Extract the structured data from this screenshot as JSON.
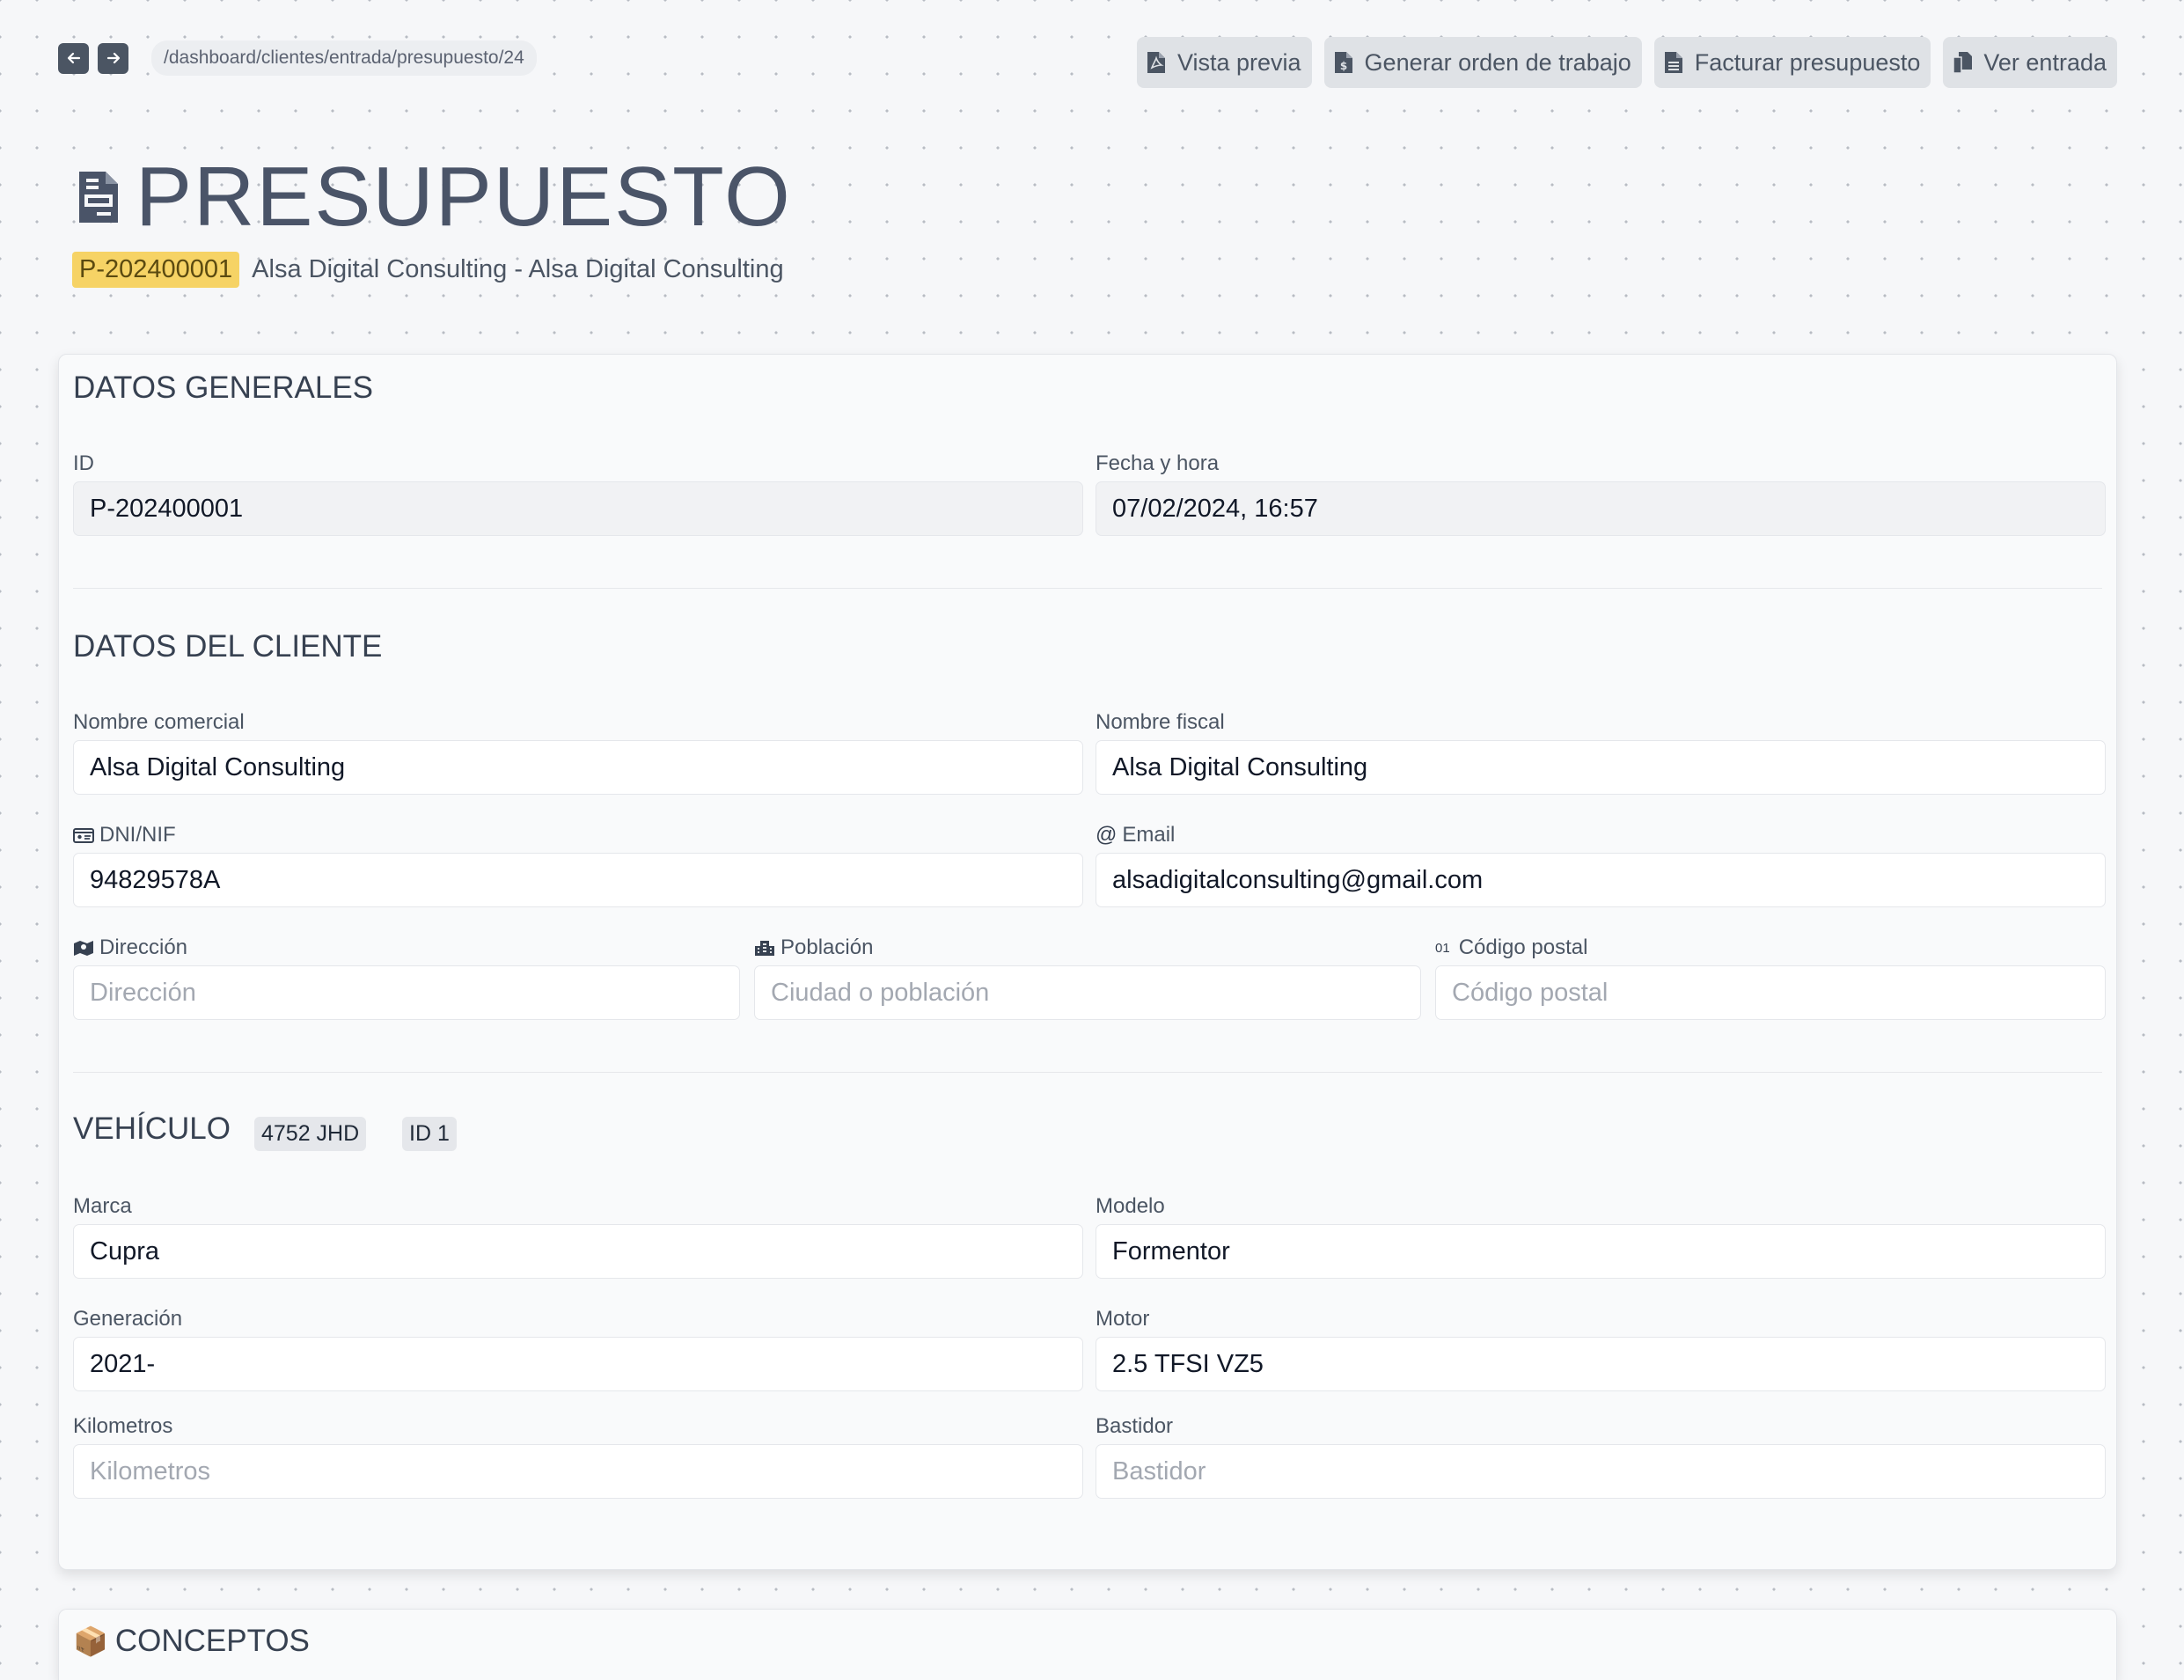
{
  "breadcrumb": "/dashboard/clientes/entrada/presupuesto/24",
  "actions": {
    "preview": "Vista previa",
    "work_order": "Generar orden de trabajo",
    "invoice": "Facturar presupuesto",
    "view_entry": "Ver entrada"
  },
  "header": {
    "title": "PRESUPUESTO",
    "code": "P-202400001",
    "client": "Alsa Digital Consulting - Alsa Digital Consulting"
  },
  "general": {
    "title": "DATOS GENERALES",
    "id_label": "ID",
    "id_value": "P-202400001",
    "date_label": "Fecha y hora",
    "date_value": "07/02/2024, 16:57"
  },
  "client": {
    "title": "DATOS DEL CLIENTE",
    "trade_name_label": "Nombre comercial",
    "trade_name_value": "Alsa Digital Consulting",
    "fiscal_name_label": "Nombre fiscal",
    "fiscal_name_value": "Alsa Digital Consulting",
    "dni_label": "DNI/NIF",
    "dni_value": "94829578A",
    "email_label": "Email",
    "email_prefix": "@",
    "email_value": "alsadigitalconsulting@gmail.com",
    "address_label": "Dirección",
    "address_placeholder": "Dirección",
    "city_label": "Población",
    "city_placeholder": "Ciudad o población",
    "zip_label": "Código postal",
    "zip_prefix": "01",
    "zip_placeholder": "Código postal"
  },
  "vehicle": {
    "title": "VEHÍCULO",
    "plate": "4752 JHD",
    "id_chip": "ID 1",
    "brand_label": "Marca",
    "brand_value": "Cupra",
    "model_label": "Modelo",
    "model_value": "Formentor",
    "generation_label": "Generación",
    "generation_value": "2021-",
    "engine_label": "Motor",
    "engine_value": "2.5 TFSI VZ5",
    "km_label": "Kilometros",
    "km_placeholder": "Kilometros",
    "chassis_label": "Bastidor",
    "chassis_placeholder": "Bastidor"
  },
  "concepts": {
    "title": "CONCEPTOS",
    "icon": "📦"
  }
}
